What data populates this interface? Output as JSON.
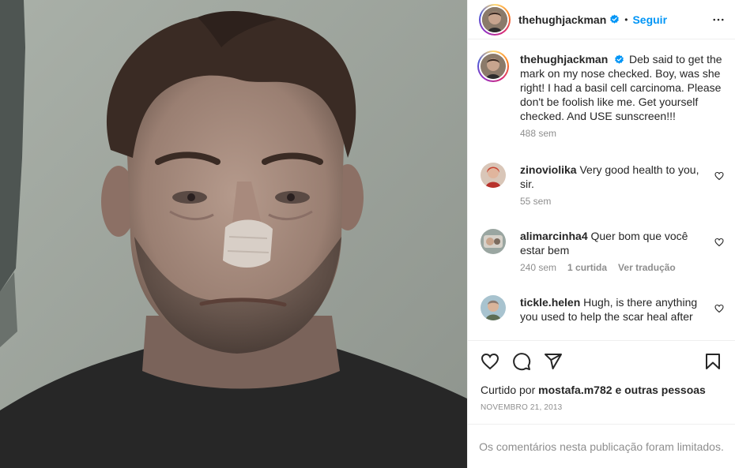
{
  "post": {
    "username": "thehughjackman",
    "follow_label": "Seguir",
    "separator": "•"
  },
  "caption": {
    "username": "thehughjackman",
    "text": "Deb said to get the mark on my nose checked. Boy, was she right! I had a basil cell carcinoma. Please don't be foolish like me. Get yourself checked. And USE sunscreen!!!",
    "time": "488 sem"
  },
  "comments": [
    {
      "username": "zinoviolika",
      "text": "Very good health to you, sir.",
      "time": "55 sem",
      "likes": "",
      "translate": ""
    },
    {
      "username": "alimarcinha4",
      "text": "Quer bom que você estar bem",
      "time": "240 sem",
      "likes": "1 curtida",
      "translate": "Ver tradução"
    },
    {
      "username": "tickle.helen",
      "text": "Hugh, is there anything you used to help the scar heal after",
      "time": "",
      "likes": "",
      "translate": ""
    }
  ],
  "likes": {
    "prefix": "Curtido por",
    "user": "mostafa.m782",
    "suffix": "e outras pessoas"
  },
  "date": "NOVEMBRO 21, 2013",
  "footer": {
    "limited_text": "Os comentários nesta publicação foram limitados."
  },
  "icons": {
    "verified": "verified-badge-icon",
    "more": "more-options-icon",
    "like": "heart-icon",
    "comment": "comment-icon",
    "share": "share-icon",
    "save": "bookmark-icon"
  },
  "colors": {
    "link": "#0095f6",
    "text": "#262626",
    "muted": "#8e8e8e"
  }
}
